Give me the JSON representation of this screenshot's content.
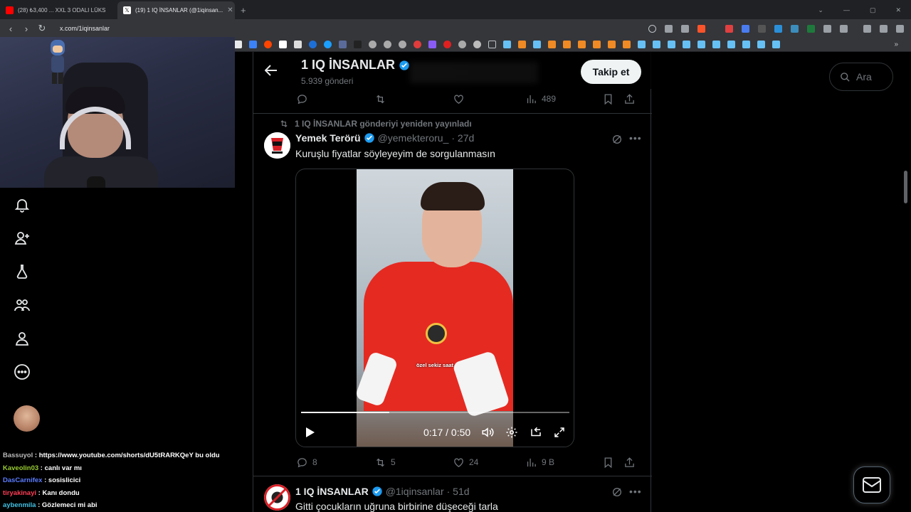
{
  "browser": {
    "tabs": [
      {
        "label": "(28) ₺3,400 ... XXL 3 ODALI LÜKS",
        "active": false,
        "favicon_color": "#ff0000"
      },
      {
        "label": "(19) 1 IQ İNSANLAR (@1iqinsan...",
        "active": true,
        "favicon_color": "#ffffff"
      }
    ],
    "new_tab": "+",
    "url": "x.com/1iqinsanlar"
  },
  "stream_chat": [
    {
      "user": "Bassuyol",
      "message": "https://www.youtube.com/shorts/dU5tRARKQeY bu oldu",
      "color_class": "u1"
    },
    {
      "user": "Kaveolin03",
      "message": "canlı var mı",
      "color_class": "u2"
    },
    {
      "user": "DasCarnifex",
      "message": "sosislicici",
      "color_class": "u3"
    },
    {
      "user": "tiryakinayi",
      "message": "Kanı dondu",
      "color_class": "u4"
    },
    {
      "user": "aybenmila",
      "message": "Gözlemeci mi abi",
      "color_class": "u5"
    }
  ],
  "header": {
    "title": "1 IQ İNSANLAR",
    "posts_count": "5.939 gönderi",
    "follow_label": "Takip et"
  },
  "search": {
    "placeholder": "Ara"
  },
  "prev_tweet_actions": {
    "replies": "",
    "reposts": "",
    "likes": "",
    "views": "489"
  },
  "tweet1": {
    "repost_note": "1 IQ İNSANLAR gönderiyi yeniden yayınladı",
    "name": "Yemek Terörü",
    "handle": "@yemekteroru_",
    "age": "· 27d",
    "text": "Kuruşlu fiyatlar söyleyeyim de sorgulanmasın",
    "video": {
      "subtitle": "özel sekiz saat",
      "time": "0:17 / 0:50",
      "progress": 0.33
    },
    "actions": {
      "replies": "8",
      "reposts": "5",
      "likes": "24",
      "views": "9 B"
    }
  },
  "tweet2": {
    "name": "1 IQ İNSANLAR",
    "handle": "@1iqinsanlar",
    "age": "· 51d",
    "text": "Gitti çocukların uğruna birbirine düşeceği tarla"
  },
  "colors": {
    "accent": "#1d9bf0",
    "background": "#000000",
    "border": "#2f3336",
    "muted": "#71767b"
  }
}
